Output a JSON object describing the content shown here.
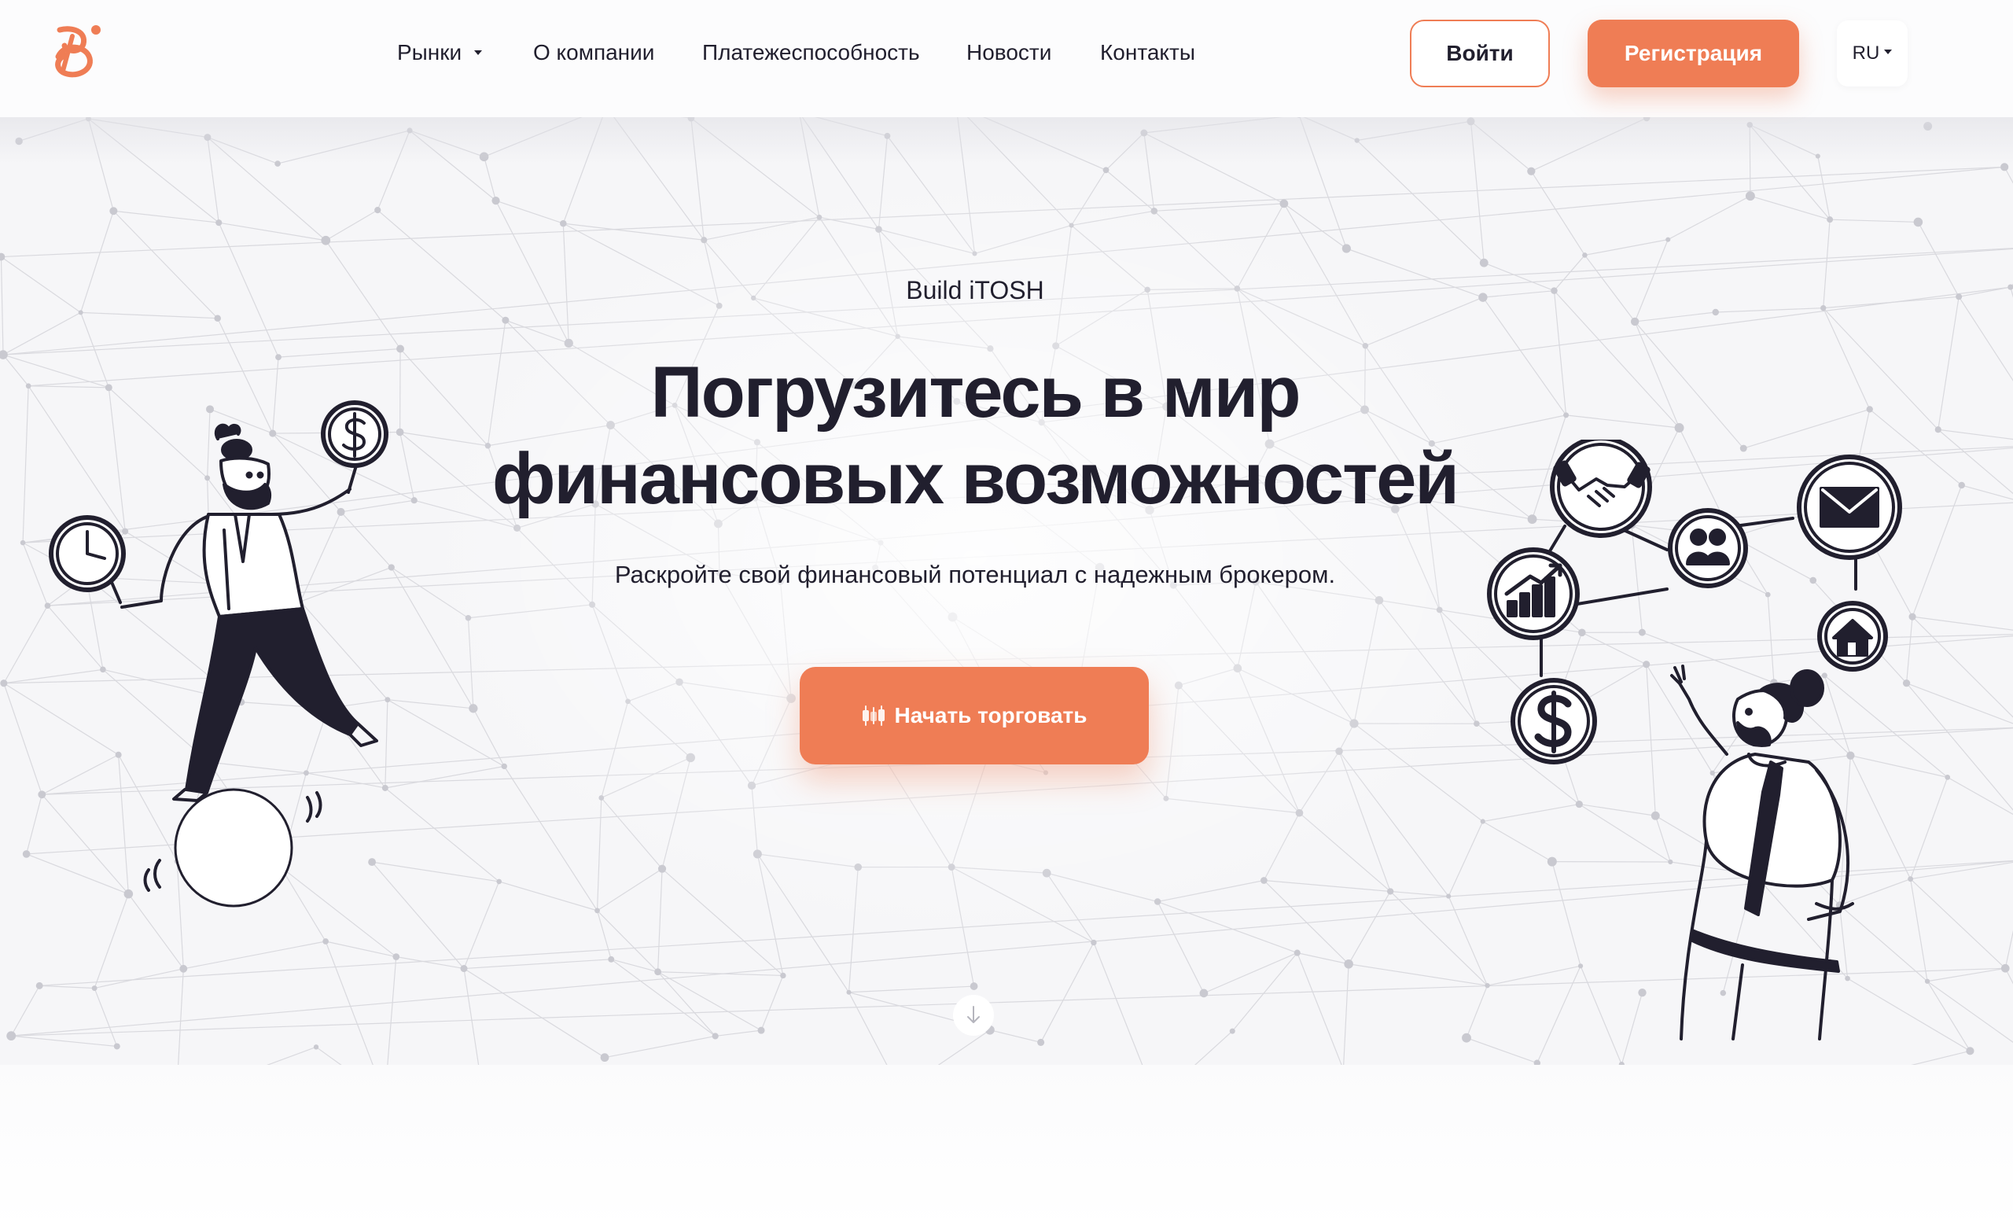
{
  "header": {
    "logo_icon": "brand-logo-icon",
    "nav": [
      {
        "label": "Рынки",
        "has_dropdown": true
      },
      {
        "label": "О компании",
        "has_dropdown": false
      },
      {
        "label": "Платежеспособность",
        "has_dropdown": false
      },
      {
        "label": "Новости",
        "has_dropdown": false
      },
      {
        "label": "Контакты",
        "has_dropdown": false
      }
    ],
    "login_label": "Войти",
    "register_label": "Регистрация",
    "language": "RU"
  },
  "hero": {
    "eyebrow": "Build iTOSH",
    "headline_line1": "Погрузитесь в мир",
    "headline_line2": "финансовых возможностей",
    "subtitle": "Раскройте свой финансовый потенциал с надежным брокером.",
    "cta_label": "Начать торговать",
    "cta_icon": "candlestick-icon",
    "scroll_icon": "arrow-down-icon"
  },
  "colors": {
    "accent": "#ef7d55",
    "text": "#211f2e",
    "hero_bg": "#f6f6f8"
  }
}
